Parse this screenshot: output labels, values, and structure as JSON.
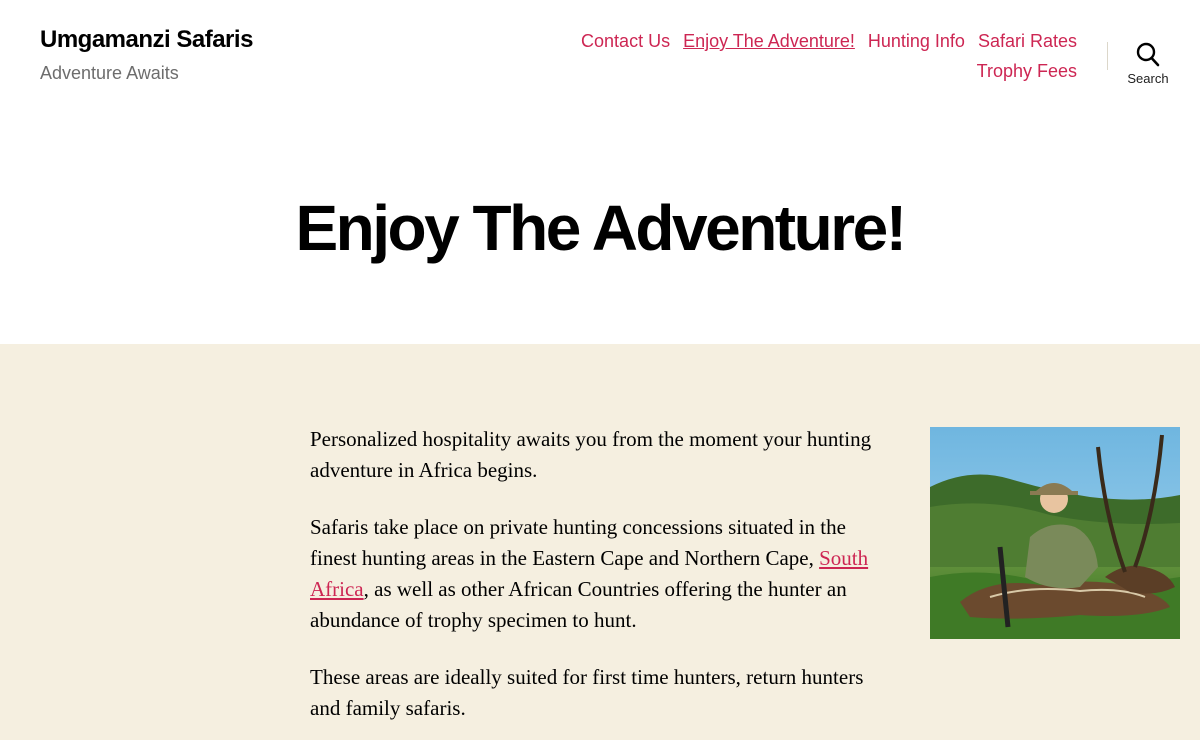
{
  "site": {
    "title": "Umgamanzi Safaris",
    "description": "Adventure Awaits"
  },
  "nav": {
    "items": [
      {
        "label": "Contact Us"
      },
      {
        "label": "Enjoy The Adventure!"
      },
      {
        "label": "Hunting Info"
      },
      {
        "label": "Safari Rates"
      },
      {
        "label": "Trophy Fees"
      }
    ],
    "current_index": 1
  },
  "search": {
    "label": "Search",
    "icon": "search-icon"
  },
  "page": {
    "title": "Enjoy The Adventure!"
  },
  "content": {
    "p1": "Personalized hospitality awaits you from the moment your hunting adventure in Africa begins.",
    "p2_before": "Safaris take place on private hunting concessions situated in the finest hunting areas in the Eastern Cape and Northern Cape, ",
    "p2_link": "South Africa",
    "p2_after": ", as well as other African Countries offering the hunter an abundance of trophy specimen to hunt.",
    "p3": "These areas are ideally suited for first time hunters, return hunters and family safaris."
  },
  "colors": {
    "accent": "#cd2653",
    "content_bg": "#f5efe0",
    "secondary_text": "#6d6d6d"
  }
}
